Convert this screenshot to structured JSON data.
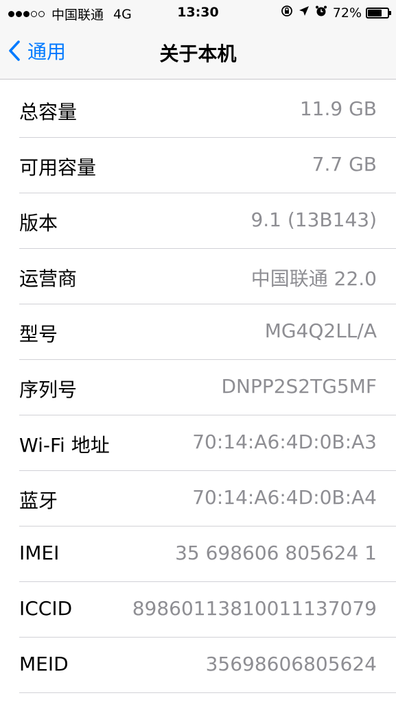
{
  "status_bar": {
    "carrier": "中国联通",
    "network": "4G",
    "time": "13:30",
    "battery_percent": "72%",
    "battery_level": 0.72,
    "signal_bars_filled": 3,
    "signal_bars_total": 5,
    "icons": [
      "orientation-lock-icon",
      "location-arrow-icon",
      "alarm-icon"
    ]
  },
  "nav": {
    "back_label": "通用",
    "title": "关于本机"
  },
  "rows": [
    {
      "label": "总容量",
      "value": "11.9 GB"
    },
    {
      "label": "可用容量",
      "value": "7.7 GB"
    },
    {
      "label": "版本",
      "value": "9.1 (13B143)"
    },
    {
      "label": "运营商",
      "value": "中国联通 22.0"
    },
    {
      "label": "型号",
      "value": "MG4Q2LL/A"
    },
    {
      "label": "序列号",
      "value": "DNPP2S2TG5MF"
    },
    {
      "label": "Wi-Fi 地址",
      "value": "70:14:A6:4D:0B:A3"
    },
    {
      "label": "蓝牙",
      "value": "70:14:A6:4D:0B:A4"
    },
    {
      "label": "IMEI",
      "value": "35 698606 805624 1"
    },
    {
      "label": "ICCID",
      "value": "89860113810011137079"
    },
    {
      "label": "MEID",
      "value": "35698606805624"
    }
  ],
  "colors": {
    "accent": "#007aff",
    "value_text": "#8e8e93",
    "separator": "#d1d1d6",
    "bar_background": "#f7f7f7"
  }
}
